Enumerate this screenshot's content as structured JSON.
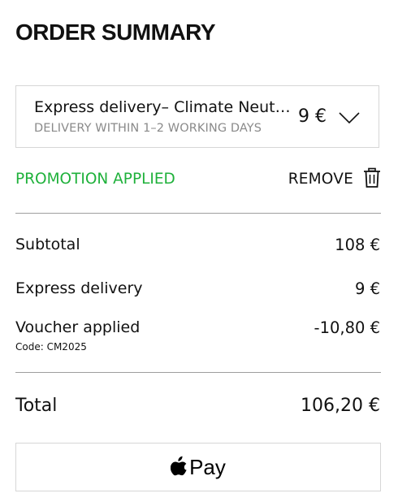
{
  "header": {
    "title": "ORDER SUMMARY"
  },
  "delivery": {
    "name": "Express delivery– Climate Neutral",
    "subtitle": "DELIVERY WITHIN 1–2 WORKING DAYS",
    "price": "9 €",
    "icon": "chevron-down-icon"
  },
  "promotion": {
    "status": "PROMOTION APPLIED",
    "status_color": "#1fb13b",
    "remove_label": "REMOVE",
    "remove_icon": "trash-icon"
  },
  "summary": {
    "subtotal_label": "Subtotal",
    "subtotal_value": "108 €",
    "shipping_label": "Express delivery",
    "shipping_value": "9 €",
    "voucher_label": "Voucher applied",
    "voucher_value": "-10,80 €",
    "voucher_code": "Code: CM2025"
  },
  "total": {
    "label": "Total",
    "value": "106,20 €"
  },
  "payment": {
    "label": "Pay",
    "icon": "apple-logo-icon"
  }
}
